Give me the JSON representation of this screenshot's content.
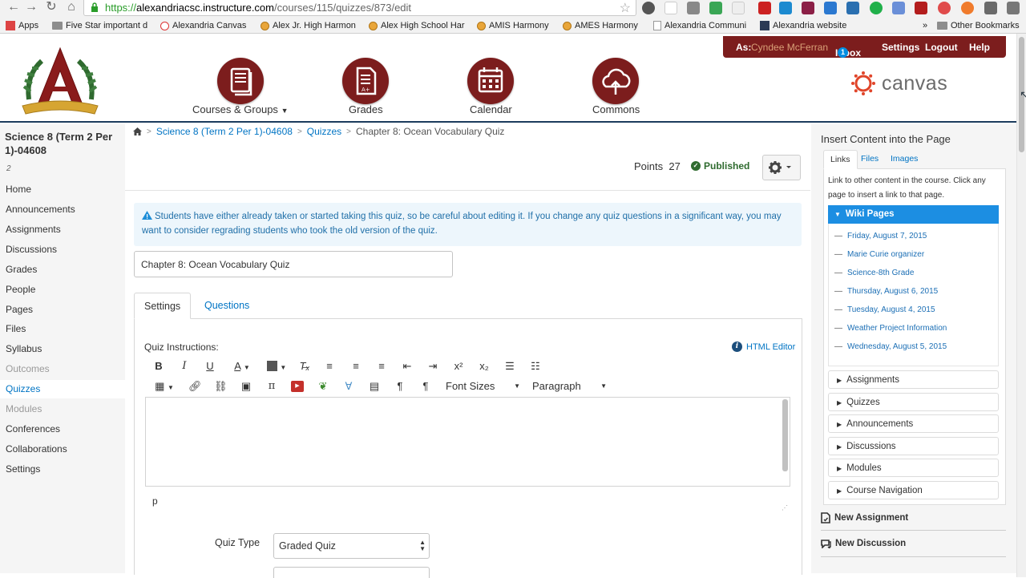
{
  "browser": {
    "url_scheme": "https://",
    "url_domain": "alexandriacsc.instructure.com",
    "url_path": "/courses/115/quizzes/873/edit",
    "bookmarks": [
      {
        "label": "Apps",
        "icon": "apps-grid-icon"
      },
      {
        "label": "Five Star important d",
        "icon": "folder-icon"
      },
      {
        "label": "Alexandria Canvas",
        "icon": "canvas-icon"
      },
      {
        "label": "Alex Jr. High Harmon",
        "icon": "harmony-icon"
      },
      {
        "label": "Alex High School Har",
        "icon": "harmony-icon"
      },
      {
        "label": "AMIS Harmony",
        "icon": "harmony-icon"
      },
      {
        "label": "AMES Harmony",
        "icon": "harmony-icon"
      },
      {
        "label": "Alexandria Communi",
        "icon": "page-icon"
      },
      {
        "label": "Alexandria website",
        "icon": "site-icon"
      }
    ],
    "more_bookmarks": "»",
    "other_bookmarks": "Other Bookmarks"
  },
  "header": {
    "nav": [
      {
        "label": "Courses & Groups",
        "icon": "courses-icon",
        "has_menu": true
      },
      {
        "label": "Grades",
        "icon": "grades-icon"
      },
      {
        "label": "Calendar",
        "icon": "calendar-icon"
      },
      {
        "label": "Commons",
        "icon": "commons-icon"
      }
    ],
    "user_menu": {
      "as_label": "As:",
      "user_name": "Cyndee McFerran",
      "inbox": "Inbox",
      "inbox_count": "1",
      "settings": "Settings",
      "logout": "Logout",
      "help": "Help"
    },
    "brand": "canvas",
    "accent_color": "#7c1d1d"
  },
  "course": {
    "title": "Science 8 (Term 2 Per 1)-04608",
    "subtitle": "2",
    "nav": [
      {
        "label": "Home",
        "state": "normal"
      },
      {
        "label": "Announcements",
        "state": "normal"
      },
      {
        "label": "Assignments",
        "state": "normal"
      },
      {
        "label": "Discussions",
        "state": "normal"
      },
      {
        "label": "Grades",
        "state": "normal"
      },
      {
        "label": "People",
        "state": "normal"
      },
      {
        "label": "Pages",
        "state": "normal"
      },
      {
        "label": "Files",
        "state": "normal"
      },
      {
        "label": "Syllabus",
        "state": "normal"
      },
      {
        "label": "Outcomes",
        "state": "dim"
      },
      {
        "label": "Quizzes",
        "state": "active"
      },
      {
        "label": "Modules",
        "state": "dim"
      },
      {
        "label": "Conferences",
        "state": "normal"
      },
      {
        "label": "Collaborations",
        "state": "normal"
      },
      {
        "label": "Settings",
        "state": "normal"
      }
    ]
  },
  "breadcrumb": [
    "Science 8 (Term 2 Per 1)-04608",
    "Quizzes",
    "Chapter 8: Ocean Vocabulary Quiz"
  ],
  "quiz": {
    "points_label": "Points",
    "points_value": "27",
    "status": "Published",
    "alert": "Students have either already taken or started taking this quiz, so be careful about editing it. If you change any quiz questions in a significant way, you may want to consider regrading students who took the old version of the quiz.",
    "title_value": "Chapter 8: Ocean Vocabulary Quiz",
    "tabs": [
      "Settings",
      "Questions"
    ],
    "instructions_label": "Quiz Instructions:",
    "html_editor": "HTML Editor",
    "toolbar": {
      "font_sizes": "Font Sizes",
      "paragraph": "Paragraph"
    },
    "editor_path": "p",
    "quiz_type_label": "Quiz Type",
    "quiz_type_value": "Graded Quiz"
  },
  "sidebar": {
    "heading": "Insert Content into the Page",
    "tabs": [
      "Links",
      "Files",
      "Images"
    ],
    "description": "Link to other content in the course. Click any page to insert a link to that page.",
    "wiki_header": "Wiki Pages",
    "wiki_pages": [
      "Friday, August 7, 2015",
      "Marie Curie organizer",
      "Science-8th Grade",
      "Thursday, August 6, 2015",
      "Tuesday, August 4, 2015",
      "Weather Project Information",
      "Wednesday, August 5, 2015"
    ],
    "sections": [
      "Assignments",
      "Quizzes",
      "Announcements",
      "Discussions",
      "Modules",
      "Course Navigation"
    ],
    "new_assignment": "New Assignment",
    "new_discussion": "New Discussion"
  }
}
